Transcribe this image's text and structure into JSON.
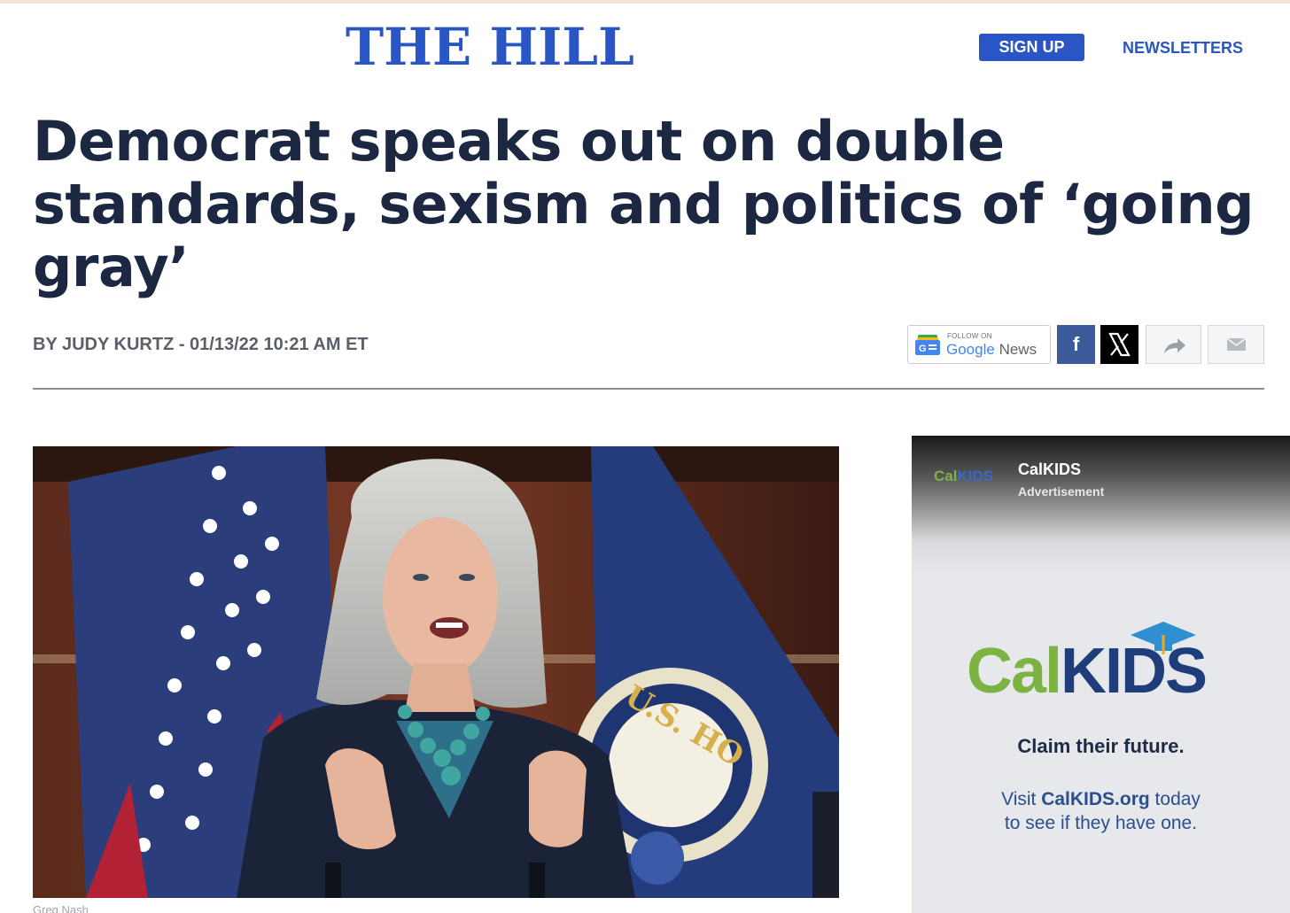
{
  "header": {
    "logo": "THE HILL",
    "signup_label": "SIGN UP",
    "newsletters_label": "NEWSLETTERS"
  },
  "article": {
    "headline": "Democrat speaks out on double standards, sexism and politics of ‘going gray’",
    "byline": "BY JUDY KURTZ - 01/13/22 10:21 AM ET",
    "photo_caption": "Greg Nash"
  },
  "share": {
    "google_news_follow": "FOLLOW ON",
    "google_news_google": "Google",
    "google_news_news": "News",
    "facebook_icon": "f",
    "icons": [
      "google-news-icon",
      "facebook-icon",
      "x-icon",
      "share-forward-icon",
      "mail-icon"
    ]
  },
  "ad": {
    "sponsor_name": "CalKIDS",
    "label": "Advertisement",
    "logo_cal": "Cal",
    "logo_kids": "KIDS",
    "tagline": "Claim their future.",
    "visit_prefix": "Visit ",
    "visit_link": "CalKIDS.org",
    "visit_suffix": " today",
    "visit_line2": "to see if they have one."
  },
  "colors": {
    "brand_blue": "#2a55c4",
    "headline": "#1c2742",
    "facebook": "#3b5a9a",
    "calkids_green": "#7cb342",
    "calkids_navy": "#1f3d7a",
    "calkids_orange": "#f5a623"
  }
}
